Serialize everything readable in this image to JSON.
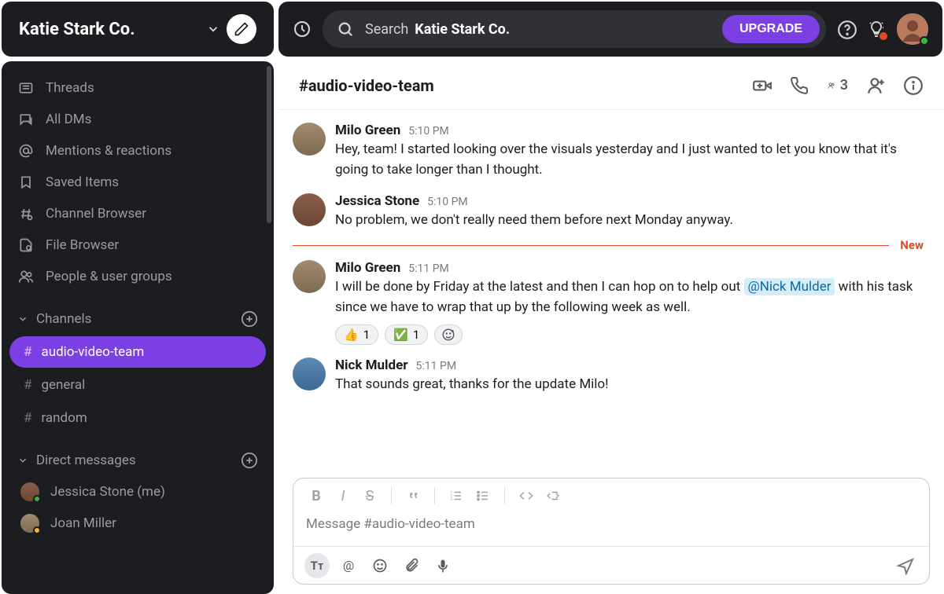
{
  "workspace": {
    "name": "Katie Stark Co."
  },
  "search": {
    "prefix": "Search",
    "scope": "Katie Stark Co."
  },
  "upgrade": {
    "label": "UPGRADE"
  },
  "sidebar": {
    "nav": [
      {
        "label": "Threads"
      },
      {
        "label": "All DMs"
      },
      {
        "label": "Mentions & reactions"
      },
      {
        "label": "Saved Items"
      },
      {
        "label": "Channel Browser"
      },
      {
        "label": "File Browser"
      },
      {
        "label": "People & user groups"
      }
    ],
    "channels_header": "Channels",
    "channels": [
      {
        "name": "audio-video-team",
        "active": true
      },
      {
        "name": "general",
        "active": false
      },
      {
        "name": "random",
        "active": false
      }
    ],
    "dm_header": "Direct messages",
    "dms": [
      {
        "name": "Jessica Stone (me)"
      },
      {
        "name": "Joan Miller"
      }
    ]
  },
  "channel": {
    "title": "#audio-video-team",
    "member_count": "3",
    "composer_placeholder": "Message #audio-video-team"
  },
  "divider": {
    "new_label": "New"
  },
  "messages": [
    {
      "author": "Milo Green",
      "time": "5:10 PM",
      "text": "Hey, team! I started looking over the visuals yesterday and I just wanted to let you know that it's going to take longer than I thought.",
      "avatar": "av1"
    },
    {
      "author": "Jessica Stone",
      "time": "5:10 PM",
      "text": "No problem, we don't really need them before next Monday anyway.",
      "avatar": "av2"
    },
    {
      "author": "Milo Green",
      "time": "5:11 PM",
      "text_pre": "I will be done by Friday at the latest and then I can hop on to help out ",
      "mention": "@Nick Mulder",
      "text_post": " with his task since we have to wrap that up by the following week as well.",
      "avatar": "av1"
    },
    {
      "author": "Nick Mulder",
      "time": "5:11 PM",
      "text": "That sounds great, thanks for the update Milo!",
      "avatar": "av3"
    }
  ],
  "reactions": [
    {
      "emoji": "👍",
      "count": "1"
    },
    {
      "emoji": "✅",
      "count": "1"
    }
  ]
}
